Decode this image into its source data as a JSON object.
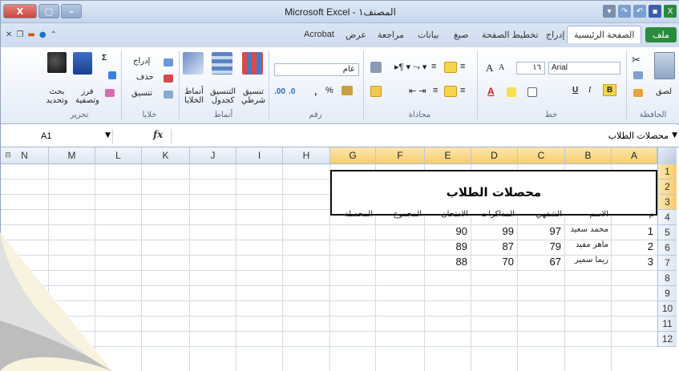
{
  "window": {
    "title": "Microsoft Excel - المصنف١",
    "buttons": {
      "close": "X",
      "restore": "▢",
      "minimize": "–"
    }
  },
  "tabs": {
    "file": "ملف",
    "home": "الصفحة الرئيسية",
    "insert": "إدراج",
    "page_layout": "تخطيط الصفحة",
    "formulas": "صيغ",
    "data": "بيانات",
    "review": "مراجعة",
    "view": "عرض",
    "acrobat": "Acrobat"
  },
  "ribbon": {
    "groups": {
      "clipboard": "الحافظة",
      "font": "خط",
      "alignment": "محاذاة",
      "number": "رقم",
      "styles": "أنماط",
      "cells": "خلايا",
      "editing": "تحرير"
    },
    "clipboard": {
      "paste": "لصق"
    },
    "font": {
      "name": "Arial",
      "size": "١٦",
      "bold": "B",
      "italic": "I",
      "underline": "U",
      "grow": "A",
      "shrink": "A"
    },
    "number": {
      "format": "عام",
      "percent": "%",
      "comma": ",",
      "inc_decimal": ".00",
      "dec_decimal": ".0"
    },
    "styles": {
      "conditional": "تنسيق شرطي",
      "as_table": "التنسيق كجدول",
      "cell_styles": "أنماط الخلايا"
    },
    "cells": {
      "insert": "إدراج",
      "delete": "حذف",
      "format": "تنسيق"
    },
    "editing": {
      "sort": "فرز وتصفية",
      "find": "بحث وتحديد",
      "sum": "Σ"
    }
  },
  "formula_bar": {
    "name_box": "A1",
    "fx": "fx",
    "content": "محصلات الطلاب"
  },
  "grid": {
    "columns": [
      "N",
      "M",
      "L",
      "K",
      "J",
      "I",
      "H",
      "G",
      "F",
      "E",
      "D",
      "C",
      "B",
      "A"
    ],
    "rows": [
      "1",
      "2",
      "3",
      "4",
      "5",
      "6",
      "7",
      "8",
      "9",
      "10",
      "11",
      "12"
    ],
    "merged_title": "محصلات الطلاب",
    "headers": {
      "A": "م",
      "B": "الاسم",
      "C": "الشفهي",
      "D": "المذاكرات",
      "E": "الامتحان",
      "F": "المجموع",
      "G": "المحصلة"
    },
    "students": [
      {
        "no": "1",
        "name": "محمد سعيد",
        "oral": "97",
        "tests": "99",
        "exam": "90"
      },
      {
        "no": "2",
        "name": "ماهر مفيد",
        "oral": "79",
        "tests": "87",
        "exam": "89"
      },
      {
        "no": "3",
        "name": "ريما سمير",
        "oral": "67",
        "tests": "70",
        "exam": "88"
      }
    ]
  },
  "colors": {
    "file_tab": "#2b8a3e",
    "selection_header": "#f6cd6c",
    "close_button": "#c9463d"
  }
}
